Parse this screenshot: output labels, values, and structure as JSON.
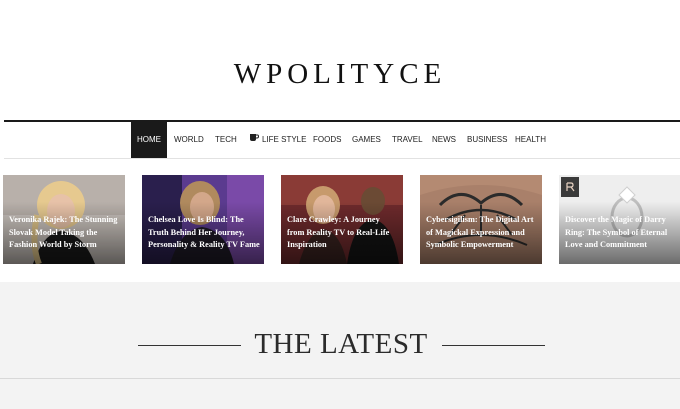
{
  "site": {
    "logo_text": "WPOLITYCE"
  },
  "nav": {
    "items": [
      {
        "label": "HOME",
        "active": true
      },
      {
        "label": "WORLD"
      },
      {
        "label": "TECH"
      },
      {
        "label": "LIFE STYLE",
        "icon": "coffee-cup-icon"
      },
      {
        "label": "FOODS"
      },
      {
        "label": "GAMES"
      },
      {
        "label": "TRAVEL"
      },
      {
        "label": "NEWS"
      },
      {
        "label": "BUSINESS"
      },
      {
        "label": "HEALTH"
      }
    ]
  },
  "featured": [
    {
      "title": "Veronika Rajek: The Stunning Slovak Model Taking the Fashion World by Storm"
    },
    {
      "title": "Chelsea Love Is Blind: The Truth Behind Her Journey, Personality & Reality TV Fame"
    },
    {
      "title": "Clare Crawley: A Journey from Reality TV to Real-Life Inspiration"
    },
    {
      "title": "Cybersigilism: The Digital Art of Magickal Expression and Symbolic Empowerment"
    },
    {
      "title": "Discover the Magic of Darry Ring: The Symbol of Eternal Love and Commitment"
    }
  ],
  "latest": {
    "heading": "THE LATEST"
  }
}
